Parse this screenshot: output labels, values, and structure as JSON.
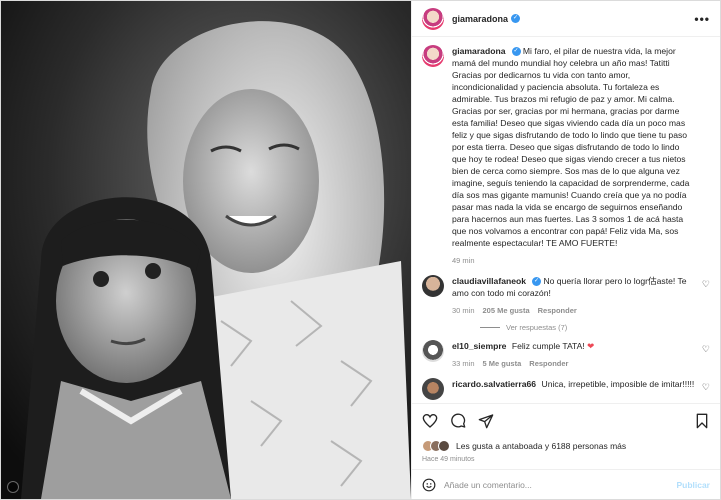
{
  "post": {
    "author": "giamaradona",
    "verified": true,
    "more_label": "•••"
  },
  "caption": {
    "author": "giamaradona",
    "text": "Mi faro, el pilar de nuestra vida, la mejor mamá del mundo mundial hoy celebra un año mas! Tatitti Gracias por dedicarnos tu vida con tanto amor, incondicionalidad y paciencia absoluta. Tu fortaleza es admirable. Tus brazos mi refugio de paz y amor. Mi calma. Gracias por ser, gracias por mi hermana, gracias por darme esta familia! Deseo que sigas viviendo cada día un poco mas feliz y que sigas disfrutando de todo lo lindo que tiene tu paso por esta tierra. Deseo que sigas disfrutando de todo lo lindo que hoy te rodea! Deseo que sigas viendo crecer a tus nietos bien de cerca como siempre. Sos mas de lo que alguna vez imagine, seguís teniendo la capacidad de sorprenderme, cada día sos mas gigante mamunis! Cuando creía que ya no podía pasar mas nada la vida se encargo de seguirnos enseñando para hacernos aun mas fuertes. Las 3 somos 1 de acá hasta que nos volvamos a encontrar con papá! Feliz vida Ma, sos realmente espectacular! TE AMO FUERTE!",
    "time": "49 min"
  },
  "comments": [
    {
      "author": "claudiavillafaneok",
      "text": "No quería llorar pero lo logr估aste! Te amo con todo mi corazón!",
      "time": "30 min",
      "likes": "205 Me gusta",
      "reply": "Responder",
      "replies": "Ver respuestas (7)"
    },
    {
      "author": "el10_siempre",
      "text": "Feliz cumple TATA!",
      "emoji": "❤",
      "time": "33 min",
      "likes": "5 Me gusta",
      "reply": "Responder"
    },
    {
      "author": "ricardo.salvatierra66",
      "text": "Unica, irrepetible, imposible de imitar!!!!!"
    }
  ],
  "footer": {
    "likes_text": "Les gusta a antaboada y 6188 personas más",
    "time_ago": "Hace 49 minutos",
    "comment_placeholder": "Añade un comentario...",
    "publish_label": "Publicar"
  },
  "icons": [
    "heart-icon",
    "comment-icon",
    "share-icon",
    "bookmark-icon",
    "emoji-icon"
  ],
  "colors": {
    "verified": "#3897f0",
    "publish": "#b2dffc",
    "heart_red": "#ed4956"
  }
}
